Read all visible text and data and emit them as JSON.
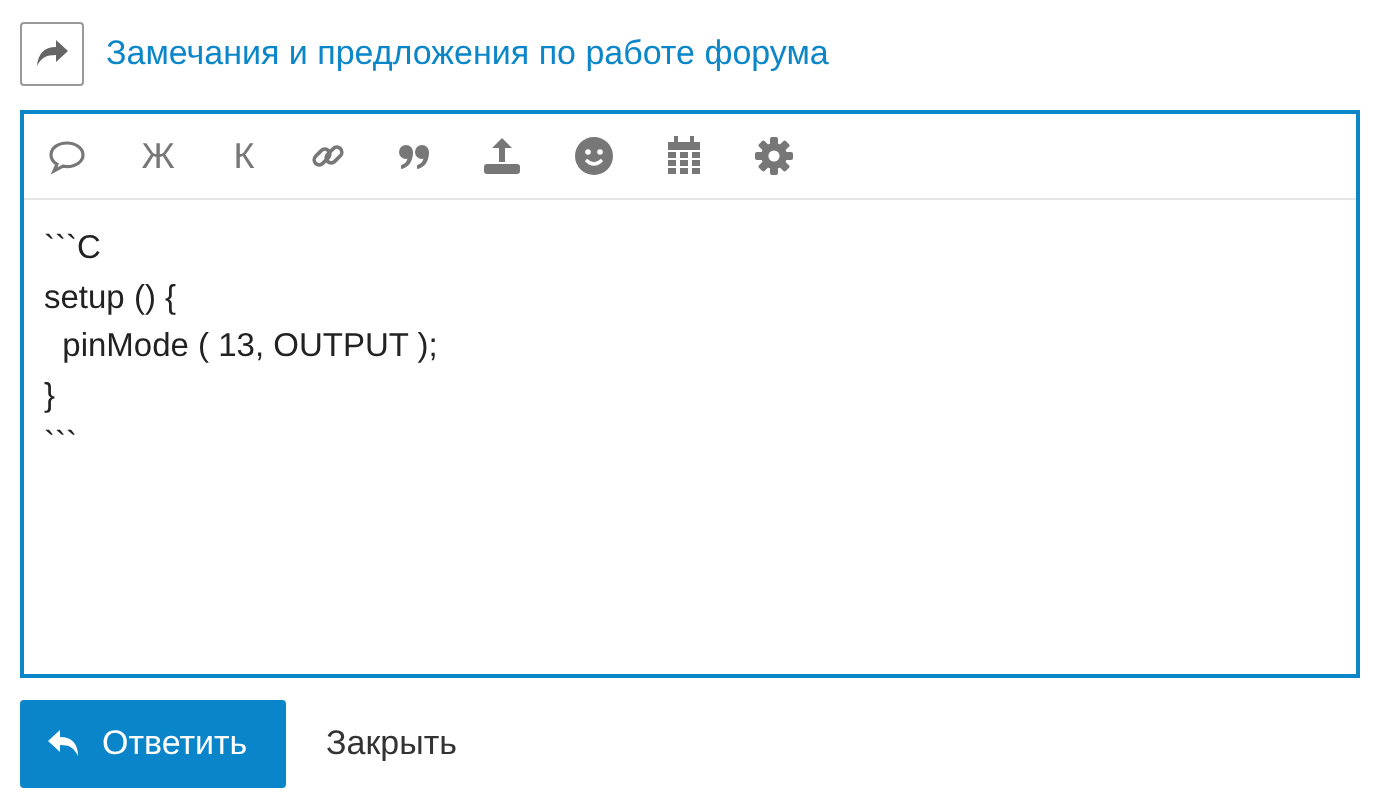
{
  "topic": {
    "title": "Замечания и предложения по работе форума"
  },
  "toolbar": [
    {
      "kind": "bubble"
    },
    {
      "kind": "text",
      "label": "Ж"
    },
    {
      "kind": "text",
      "label": "К"
    },
    {
      "kind": "link"
    },
    {
      "kind": "quote"
    },
    {
      "kind": "upload"
    },
    {
      "kind": "smiley"
    },
    {
      "kind": "calendar"
    },
    {
      "kind": "gear"
    }
  ],
  "editor": {
    "value": "```C\nsetup () {\n  pinMode ( 13, OUTPUT );\n}\n```"
  },
  "buttons": {
    "reply": "Ответить",
    "close": "Закрыть"
  }
}
